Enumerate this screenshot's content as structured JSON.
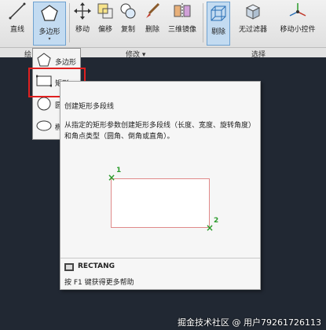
{
  "ribbon": {
    "line": "直线",
    "polygon": "多边形",
    "move": "移动",
    "offset": "偏移",
    "copy": "复制",
    "delete": "删除",
    "mirror3d": "三维镜像",
    "remove": "剔除",
    "nofilter": "无过滤器",
    "gizmo": "移动小控件"
  },
  "panels": {
    "draw": "绘",
    "modify": "修改 ▾",
    "select": "选择"
  },
  "dropdown": {
    "polygon": "多边形",
    "rect": "矩形",
    "item3": "圆",
    "item4": "椭"
  },
  "tooltip": {
    "title": "创建矩形多段线",
    "desc": "从指定的矩形参数创建矩形多段线（长度、宽度、旋转角度）和角点类型（圆角、倒角或直角）。",
    "p1": "1",
    "p2": "2",
    "command": "RECTANG",
    "help": "按 F1 键获得更多帮助"
  },
  "watermark": "掘金技术社区 @ 用户79261726113"
}
